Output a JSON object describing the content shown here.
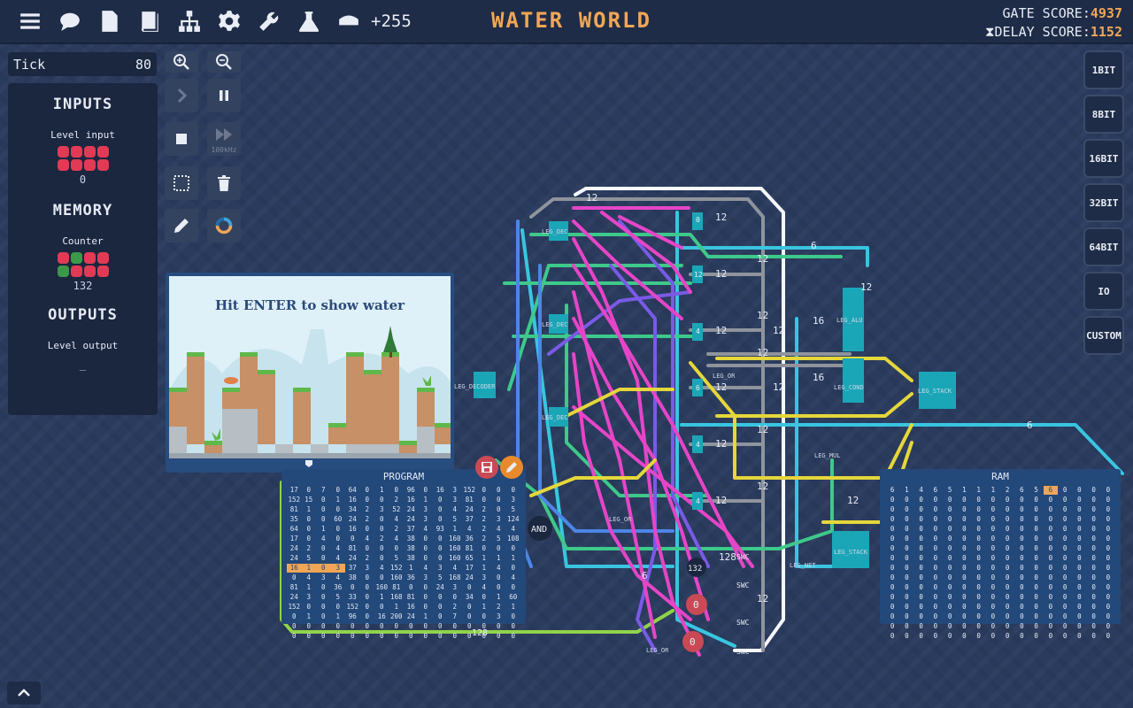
{
  "topbar": {
    "icons": [
      "menu-icon",
      "chat-icon",
      "document-icon",
      "book-icon",
      "hierarchy-icon",
      "gear-icon",
      "wrench-icon",
      "flask-icon",
      "scanner-icon"
    ],
    "credits": "+255",
    "title": "WATER WORLD",
    "gate_score_label": "GATE SCORE:",
    "gate_score": "4937",
    "delay_score_label": "DELAY SCORE:",
    "delay_score": "1152"
  },
  "tick": {
    "label": "Tick",
    "value": "80"
  },
  "side": {
    "inputs_heading": "INPUTS",
    "level_input_label": "Level input",
    "level_input_value": "0",
    "memory_heading": "MEMORY",
    "counter_label": "Counter",
    "counter_value": "132",
    "outputs_heading": "OUTPUTS",
    "level_output_label": "Level output",
    "level_output_value": "_"
  },
  "tools": {
    "speed_label": "100kHz"
  },
  "preview": {
    "message": "Hit ENTER to show water"
  },
  "program": {
    "title": "PROGRAM",
    "rows": [
      [
        "17",
        "0",
        "7",
        "0",
        "64",
        "0",
        "1",
        "0",
        "96",
        "0",
        "16",
        "3",
        "152",
        "0",
        "0",
        "0"
      ],
      [
        "152",
        "15",
        "0",
        "1",
        "16",
        "0",
        "0",
        "2",
        "16",
        "1",
        "0",
        "3",
        "81",
        "0",
        "0",
        "3"
      ],
      [
        "81",
        "1",
        "0",
        "0",
        "34",
        "2",
        "3",
        "52",
        "24",
        "3",
        "0",
        "4",
        "24",
        "2",
        "0",
        "5"
      ],
      [
        "35",
        "0",
        "0",
        "60",
        "24",
        "2",
        "0",
        "4",
        "24",
        "3",
        "0",
        "5",
        "37",
        "2",
        "3",
        "124"
      ],
      [
        "64",
        "0",
        "1",
        "0",
        "16",
        "0",
        "0",
        "2",
        "37",
        "4",
        "93",
        "1",
        "4",
        "2",
        "4",
        "4"
      ],
      [
        "17",
        "0",
        "4",
        "0",
        "0",
        "4",
        "2",
        "4",
        "38",
        "0",
        "0",
        "160",
        "36",
        "2",
        "5",
        "108"
      ],
      [
        "24",
        "2",
        "0",
        "4",
        "81",
        "0",
        "0",
        "0",
        "38",
        "0",
        "0",
        "160",
        "81",
        "0",
        "0",
        "0"
      ],
      [
        "24",
        "5",
        "0",
        "4",
        "24",
        "2",
        "0",
        "5",
        "38",
        "0",
        "0",
        "160",
        "65",
        "1",
        "1",
        "1"
      ],
      [
        "16",
        "1",
        "0",
        "3",
        "37",
        "3",
        "4",
        "152",
        "1",
        "4",
        "3",
        "4",
        "17",
        "1",
        "4",
        "0"
      ],
      [
        "0",
        "4",
        "3",
        "4",
        "38",
        "0",
        "0",
        "160",
        "36",
        "3",
        "5",
        "168",
        "24",
        "3",
        "0",
        "4"
      ],
      [
        "81",
        "1",
        "0",
        "36",
        "0",
        "0",
        "160",
        "81",
        "0",
        "0",
        "24",
        "3",
        "0",
        "4",
        "0",
        "0"
      ],
      [
        "24",
        "3",
        "0",
        "5",
        "33",
        "0",
        "1",
        "168",
        "81",
        "0",
        "0",
        "0",
        "34",
        "0",
        "1",
        "60"
      ],
      [
        "152",
        "0",
        "0",
        "0",
        "152",
        "0",
        "0",
        "1",
        "16",
        "0",
        "0",
        "2",
        "0",
        "1",
        "2",
        "1"
      ],
      [
        "0",
        "1",
        "0",
        "1",
        "96",
        "0",
        "16",
        "200",
        "24",
        "1",
        "0",
        "7",
        "0",
        "0",
        "3",
        "0"
      ],
      [
        "0",
        "0",
        "0",
        "0",
        "0",
        "0",
        "0",
        "0",
        "0",
        "0",
        "0",
        "0",
        "0",
        "0",
        "0",
        "0"
      ],
      [
        "0",
        "0",
        "0",
        "0",
        "0",
        "0",
        "0",
        "0",
        "0",
        "0",
        "0",
        "0",
        "0",
        "0",
        "0",
        "0"
      ]
    ]
  },
  "ram": {
    "title": "RAM",
    "first_row": [
      "6",
      "1",
      "4",
      "6",
      "5",
      "1",
      "1",
      "1",
      "2",
      "6",
      "5",
      "6",
      "0",
      "0",
      "0",
      "0"
    ],
    "highlight_col": 11
  },
  "bit_buttons": [
    "1BIT",
    "8BIT",
    "16BIT",
    "32BIT",
    "64BIT",
    "IO",
    "CUSTOM"
  ],
  "circuit": {
    "labels": [
      "LEG_DEC",
      "LEG_DEC",
      "LEG_DEC",
      "LEG_DECODER",
      "LEG_ALU",
      "LEG_COND",
      "LEG_STACK",
      "LEG_STACK",
      "LEG_OR",
      "LEG_OR",
      "LEG_MUL",
      "LEG_OR",
      "AND",
      "SWC",
      "132",
      "0",
      "0",
      "128"
    ],
    "and_label": "AND",
    "counter_node": "132",
    "zero_a": "0",
    "zero_b": "0",
    "wire_label_128": "128"
  },
  "colors": {
    "accent": "#f0a656",
    "background": "#2a3b5e",
    "panel": "#1b263f",
    "led_red": "#e23a55",
    "led_green": "#3a9a48"
  }
}
